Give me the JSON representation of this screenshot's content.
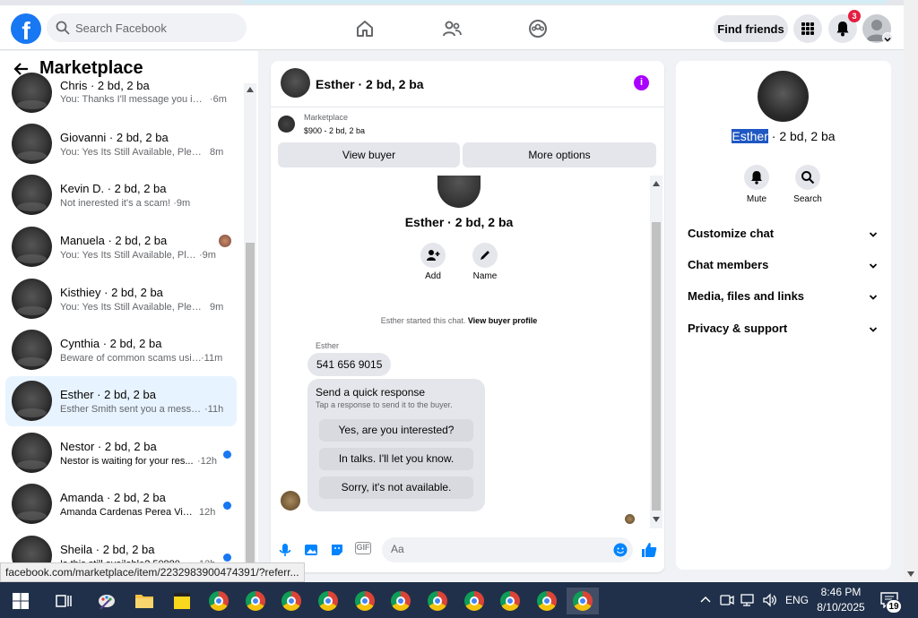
{
  "header": {
    "logo": "f",
    "search_placeholder": "Search Facebook",
    "find_friends": "Find friends",
    "notif_count": "3"
  },
  "left": {
    "title": "Marketplace",
    "conversations": [
      {
        "name": "Chris · 2 bd, 2 ba",
        "snippet": "You: Thanks I'll message you in a ...",
        "time": "·6m"
      },
      {
        "name": "Giovanni · 2 bd, 2 ba",
        "snippet": "You: Yes Its Still Available, Please ...",
        "time": "8m"
      },
      {
        "name": "Kevin D. · 2 bd, 2 ba",
        "snippet": "Not inerested it's a scam! ·9m",
        "time": ""
      },
      {
        "name": "Manuela · 2 bd, 2 ba",
        "snippet": "You: Yes Its Still Available, Pleas...",
        "time": "·9m"
      },
      {
        "name": "Kisthiey · 2 bd, 2 ba",
        "snippet": "You: Yes Its Still Available, Please ...",
        "time": "9m"
      },
      {
        "name": "Cynthia · 2 bd, 2 ba",
        "snippet": "Beware of common scams using...",
        "time": "·11m"
      },
      {
        "name": "Esther · 2 bd, 2 ba",
        "snippet": "Esther Smith sent you a message...",
        "time": "·11h"
      },
      {
        "name": "Nestor · 2 bd, 2 ba",
        "snippet": "Nestor is waiting for your res...",
        "time": "·12h"
      },
      {
        "name": "Amanda · 2 bd, 2 ba",
        "snippet": "Amanda Cardenas Perea Villa...",
        "time": "12h"
      },
      {
        "name": "Sheila · 2 bd, 2 ba",
        "snippet": "Is this still available? 5088022...",
        "time": "12h"
      }
    ]
  },
  "chat": {
    "title": "Esther · 2 bd, 2 ba",
    "marketplace_label": "Marketplace",
    "listing": "$900 - 2 bd, 2 ba",
    "view_buyer": "View buyer",
    "more_options": "More options",
    "big_name": "Esther · 2 bd, 2 ba",
    "add_label": "Add",
    "name_label": "Name",
    "system_text": "Esther started this chat.",
    "system_link": "View buyer profile",
    "sender": "Esther",
    "message": "541 656 9015",
    "quick_title": "Send a quick response",
    "quick_sub": "Tap a response to send it to the buyer.",
    "quick_1": "Yes, are you interested?",
    "quick_2": "In talks. I'll let you know.",
    "quick_3": "Sorry, it's not available.",
    "composer_placeholder": "Aa",
    "gif": "GIF"
  },
  "right": {
    "name_highlight": "Esther",
    "name_rest": " · 2 bd, 2 ba",
    "mute": "Mute",
    "search": "Search",
    "items": [
      "Customize chat",
      "Chat members",
      "Media, files and links",
      "Privacy & support"
    ]
  },
  "status_url": "facebook.com/marketplace/item/2232983900474391/?referr...",
  "taskbar": {
    "lang": "ENG",
    "time": "8:46 PM",
    "date": "8/10/2025",
    "notif": "19"
  }
}
